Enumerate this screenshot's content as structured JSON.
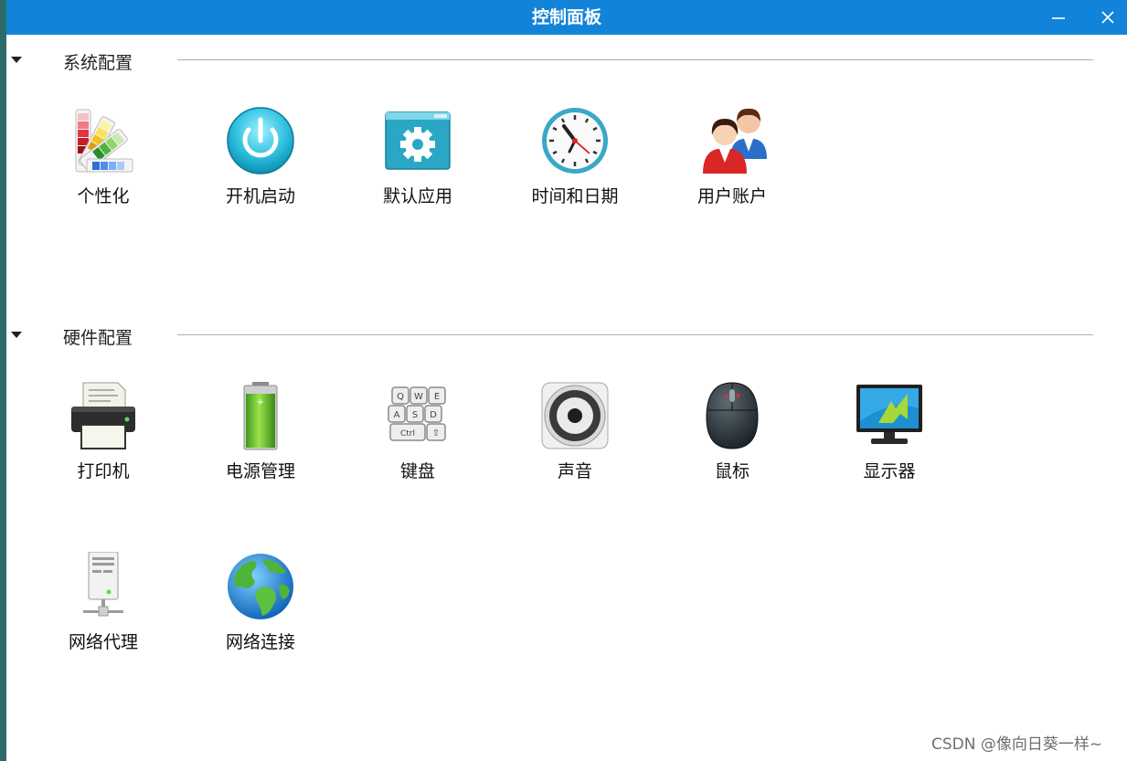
{
  "window": {
    "title": "控制面板"
  },
  "sections": [
    {
      "title": "系统配置",
      "items": [
        {
          "label": "个性化",
          "icon": "color-palette-icon"
        },
        {
          "label": "开机启动",
          "icon": "power-icon"
        },
        {
          "label": "默认应用",
          "icon": "app-gear-icon"
        },
        {
          "label": "时间和日期",
          "icon": "clock-icon"
        },
        {
          "label": "用户账户",
          "icon": "users-icon"
        }
      ]
    },
    {
      "title": "硬件配置",
      "items": [
        {
          "label": "打印机",
          "icon": "printer-icon"
        },
        {
          "label": "电源管理",
          "icon": "battery-icon"
        },
        {
          "label": "键盘",
          "icon": "keyboard-icon"
        },
        {
          "label": "声音",
          "icon": "speaker-icon"
        },
        {
          "label": "鼠标",
          "icon": "mouse-icon"
        },
        {
          "label": "显示器",
          "icon": "monitor-icon"
        },
        {
          "label": "网络代理",
          "icon": "proxy-server-icon"
        },
        {
          "label": "网络连接",
          "icon": "globe-icon"
        }
      ]
    }
  ],
  "keyboard_keys": [
    "Q",
    "W",
    "E",
    "A",
    "S",
    "D",
    "Ctrl",
    "⇧"
  ],
  "watermark": "CSDN @像向日葵一样~",
  "colors": {
    "titlebar": "#1183d8",
    "window_bg": "#ffffff",
    "desktop": "#2f6a6a"
  }
}
